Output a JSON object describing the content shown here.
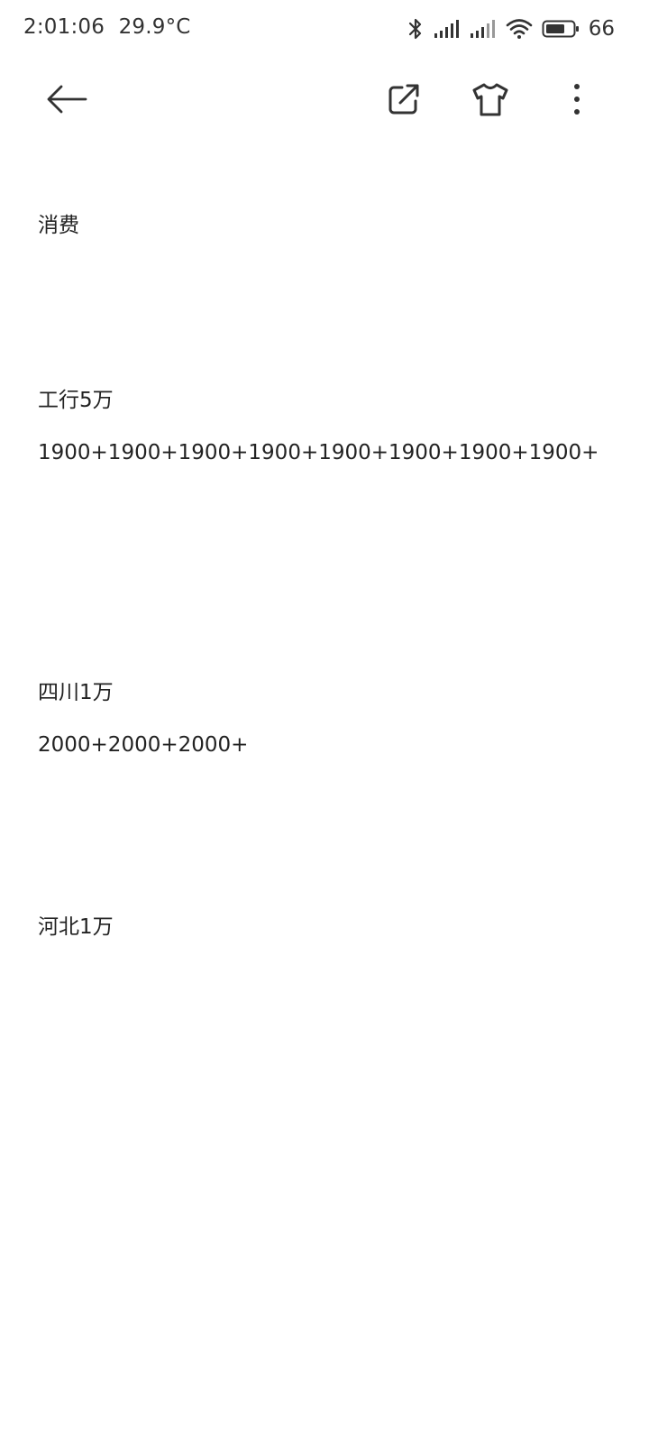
{
  "status_bar": {
    "time": "2:01:06",
    "temperature": "29.9°C",
    "battery_level": "66",
    "icons": [
      "bluetooth-icon",
      "signal-icon",
      "signal-icon",
      "wifi-icon",
      "battery-icon"
    ]
  },
  "toolbar": {
    "back_icon": "arrow-left-icon",
    "share_icon": "share-external-icon",
    "theme_icon": "tshirt-icon",
    "more_icon": "more-vertical-icon"
  },
  "note": {
    "lines": [
      "消费",
      "工行5万",
      "1900+1900+1900+1900+1900+1900+1900+1900+",
      "四川1万",
      "2000+2000+2000+",
      "河北1万"
    ]
  },
  "colors": {
    "text": "#222222",
    "icon": "#333333",
    "background": "#ffffff"
  }
}
